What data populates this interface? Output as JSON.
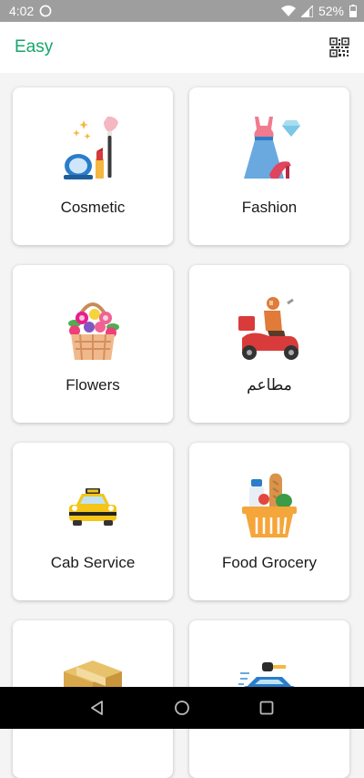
{
  "status_bar": {
    "time": "4:02",
    "battery": "52%",
    "icons": [
      "whatsapp-icon",
      "wifi-icon",
      "signal-icon",
      "battery-icon"
    ]
  },
  "app_bar": {
    "title": "Easy",
    "action_icon": "qr-code-icon"
  },
  "categories": [
    {
      "label": "Cosmetic",
      "icon": "cosmetic-icon"
    },
    {
      "label": "Fashion",
      "icon": "fashion-icon"
    },
    {
      "label": "Flowers",
      "icon": "flowers-icon"
    },
    {
      "label": "مطاعم",
      "icon": "restaurant-delivery-icon"
    },
    {
      "label": "Cab Service",
      "icon": "taxi-icon"
    },
    {
      "label": "Food Grocery",
      "icon": "grocery-basket-icon"
    },
    {
      "label": "",
      "icon": "box-icon"
    },
    {
      "label": "",
      "icon": "car-key-icon"
    }
  ],
  "nav_bar": {
    "icons": [
      "back-icon",
      "home-icon",
      "recents-icon"
    ]
  },
  "colors": {
    "accent": "#14a66b",
    "status_bar": "#9e9e9e",
    "background": "#f4f4f4"
  }
}
